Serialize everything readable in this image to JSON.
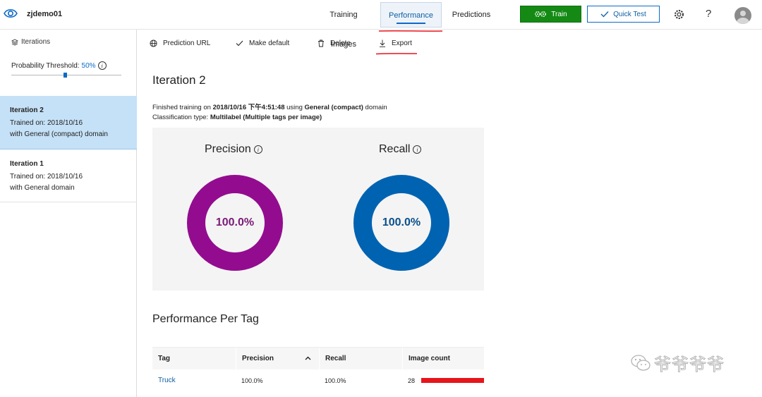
{
  "header": {
    "project_name": "zjdemo01",
    "tabs": [
      {
        "label": "Training Images"
      },
      {
        "label": "Performance"
      },
      {
        "label": "Predictions"
      }
    ],
    "train_label": "Train",
    "quick_test_label": "Quick Test",
    "help_label": "?"
  },
  "sidebar": {
    "iterations_label": "Iterations",
    "threshold_label": "Probability Threshold:",
    "threshold_value": "50%",
    "threshold_fraction": 0.5,
    "items": [
      {
        "title": "Iteration 2",
        "trained": "Trained on: 2018/10/16",
        "domain": "with General (compact) domain",
        "selected": true
      },
      {
        "title": "Iteration 1",
        "trained": "Trained on: 2018/10/16",
        "domain": "with General domain",
        "selected": false
      }
    ]
  },
  "commands": {
    "prediction_url": "Prediction URL",
    "make_default": "Make default",
    "delete": "Delete",
    "export": "Export"
  },
  "main": {
    "iteration_title": "Iteration 2",
    "finished_prefix": "Finished training on ",
    "finished_date": "2018/10/16 下午4:51:48",
    "finished_using": " using ",
    "finished_domain": "General (compact)",
    "finished_suffix": " domain",
    "class_prefix": "Classification type: ",
    "class_value": "Multilabel (Multiple tags per image)",
    "precision_label": "Precision",
    "precision_value": "100.0%",
    "recall_label": "Recall",
    "recall_value": "100.0%",
    "per_tag_title": "Performance Per Tag",
    "table": {
      "headers": [
        "Tag",
        "Precision",
        "Recall",
        "Image count"
      ],
      "rows": [
        {
          "tag": "Truck",
          "precision": "100.0%",
          "recall": "100.0%",
          "image_count": "28"
        }
      ]
    }
  },
  "watermark": {
    "text": "爷爷爷爷"
  },
  "colors": {
    "accent": "#0b6ac9",
    "train_green": "#148a14",
    "precision_purple": "#930c8f",
    "recall_blue": "#0063b1",
    "selected_bg": "#c5e1f7",
    "annotation_red": "#e8141b"
  }
}
